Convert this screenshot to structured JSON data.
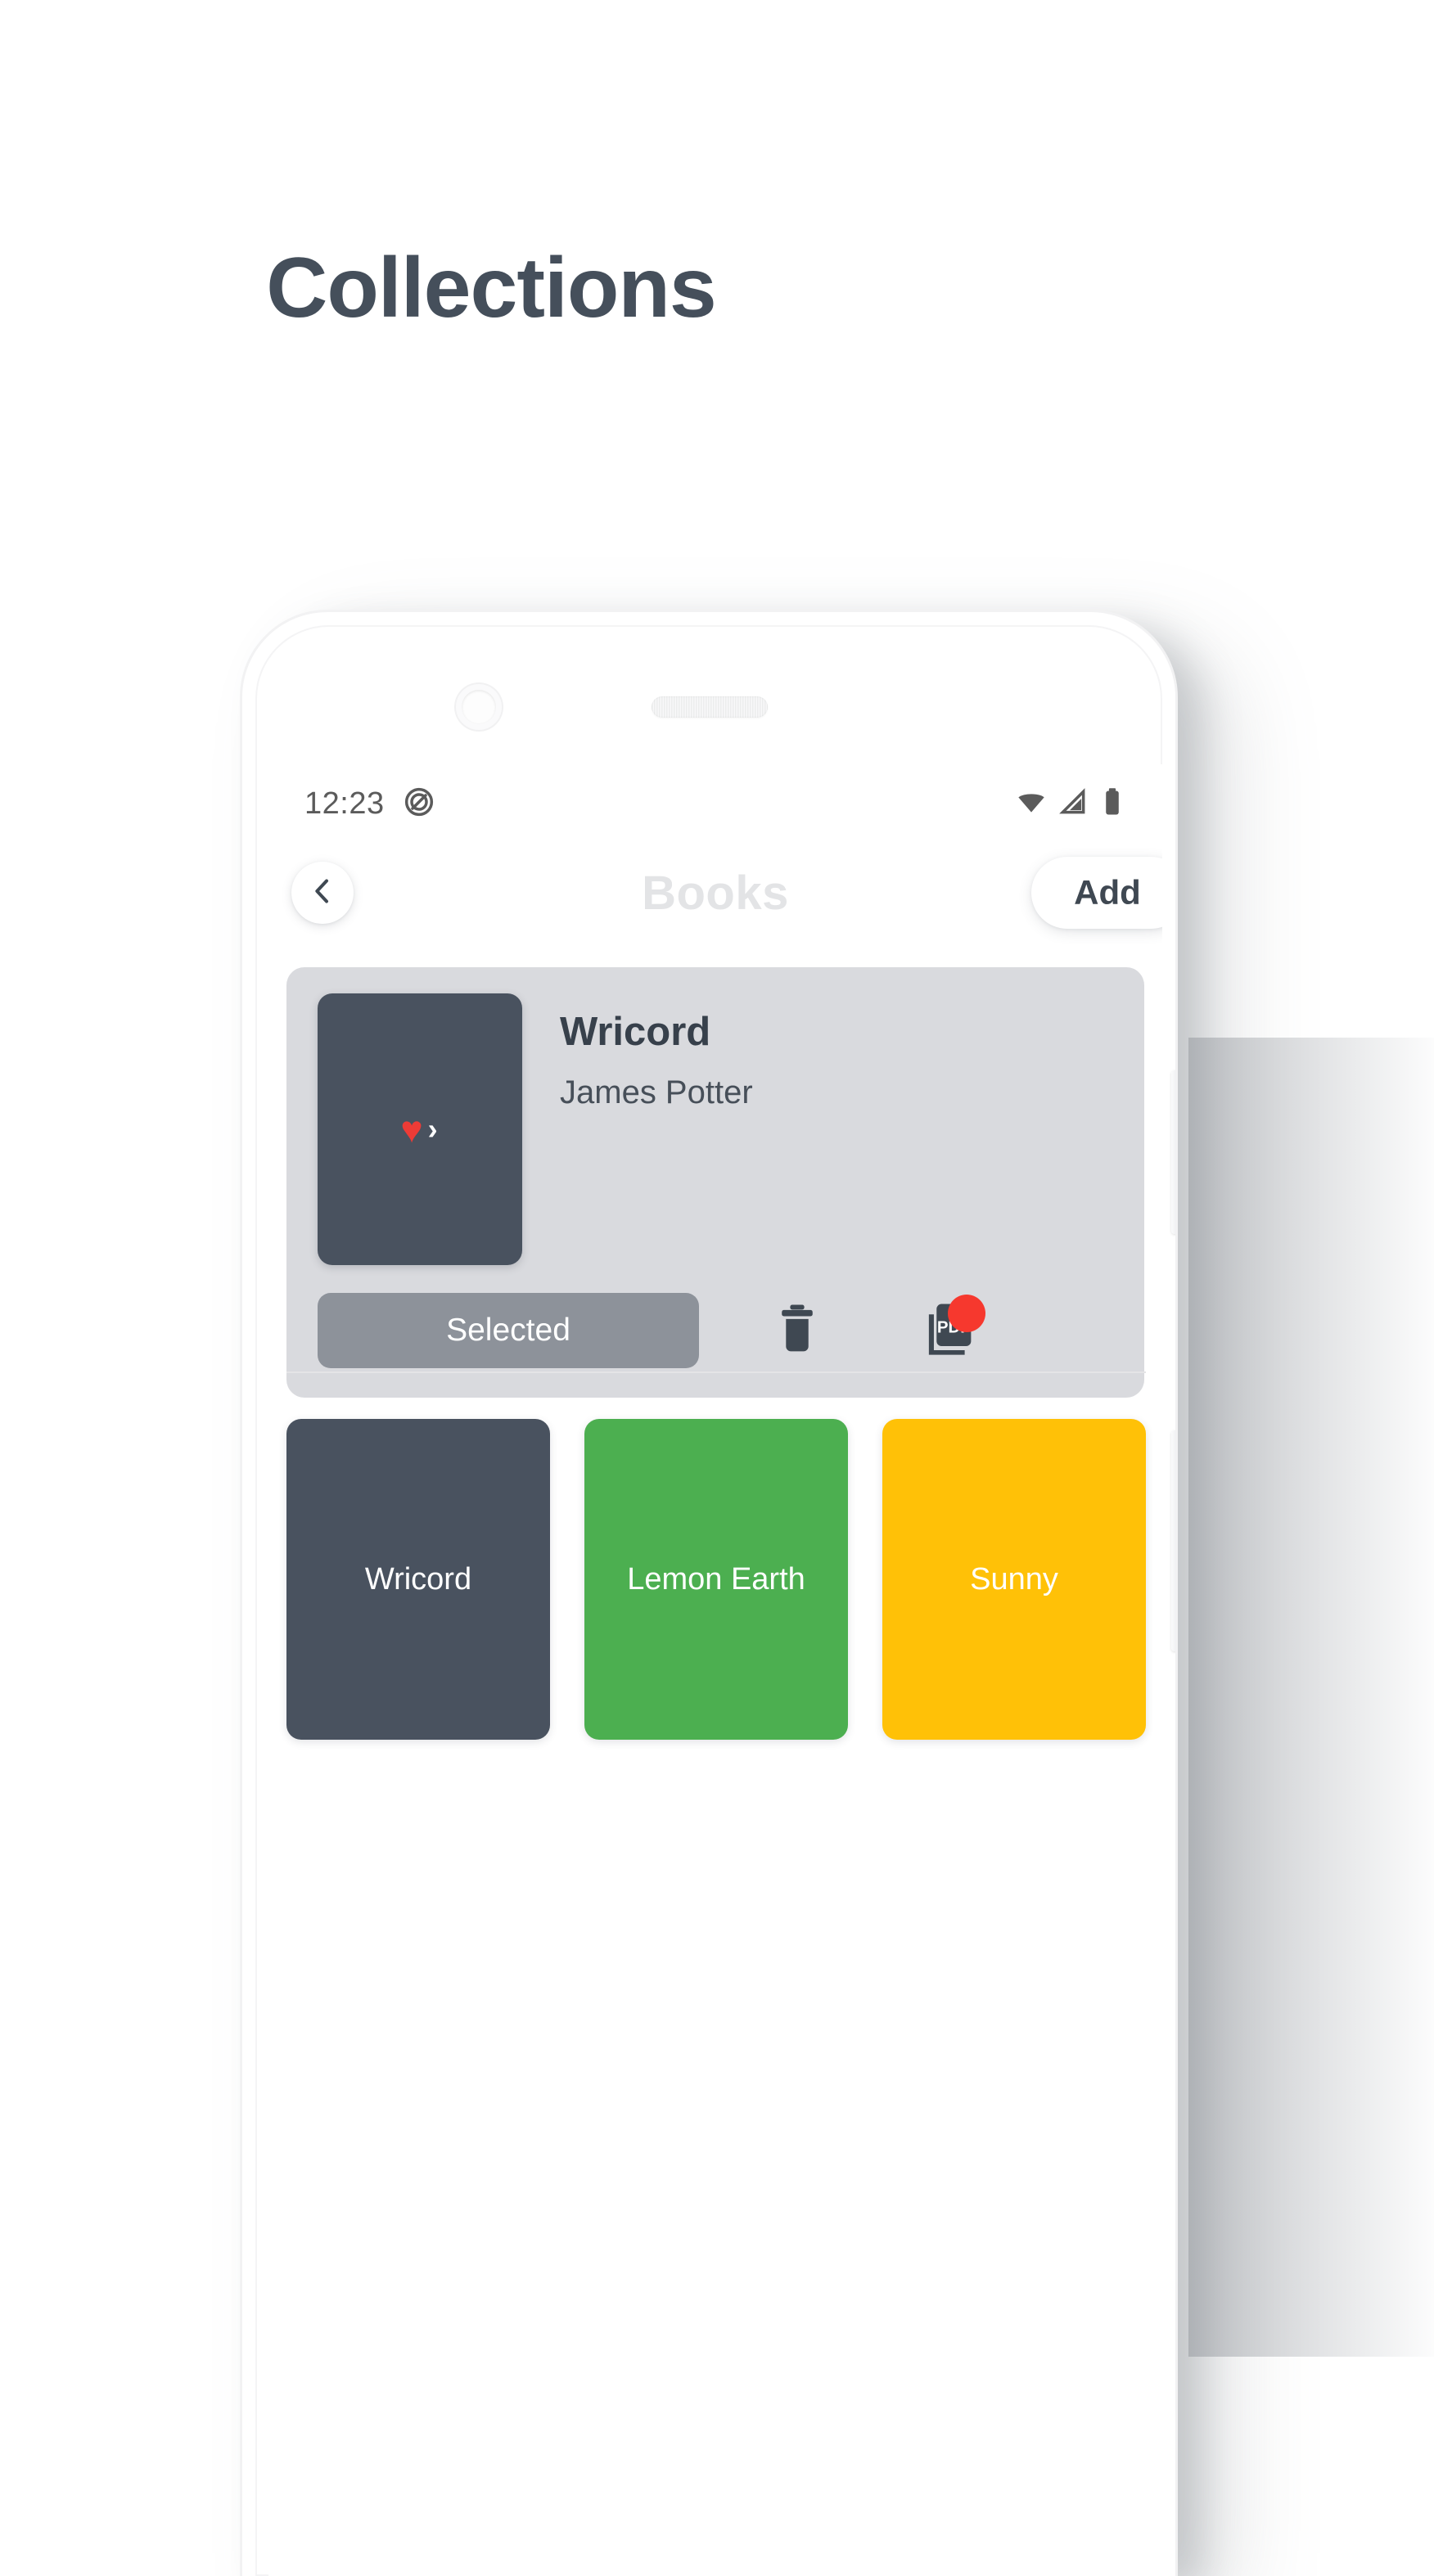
{
  "page": {
    "heading": "Collections"
  },
  "device": {
    "camera_icon": "front-camera-icon",
    "speaker_icon": "earpiece-speaker-icon",
    "volume_button": "volume-button",
    "power_button": "power-button"
  },
  "status_bar": {
    "time": "12:23",
    "notification_icon": "do-not-disturb-icon",
    "wifi_icon": "wifi-icon",
    "signal_icon": "cellular-signal-icon",
    "battery_icon": "battery-icon"
  },
  "app_bar": {
    "back_icon": "chevron-left-icon",
    "title": "Books",
    "add_label": "Add"
  },
  "detail_card": {
    "cover": {
      "heart_glyph": "♥",
      "caret_glyph": "›",
      "icon_name": "heart-caret-cover-art"
    },
    "title": "Wricord",
    "author": "James Potter",
    "selected_label": "Selected",
    "delete_icon": "trash-icon",
    "export_icon": "pdf-export-icon",
    "badge_visible": true
  },
  "themes": [
    {
      "label": "Wricord",
      "color": "#49525f"
    },
    {
      "label": "Lemon Earth",
      "color": "#4caf50"
    },
    {
      "label": "Sunny",
      "color": "#ffc107"
    }
  ],
  "colors": {
    "heading": "#454f5b",
    "card_background": "#d9dade",
    "dark_slate": "#49525f",
    "green": "#4caf50",
    "amber": "#ffc107",
    "badge_red": "#f6382e",
    "selected_gray": "#8d929a",
    "app_bar_title": "#e3e4e6"
  }
}
